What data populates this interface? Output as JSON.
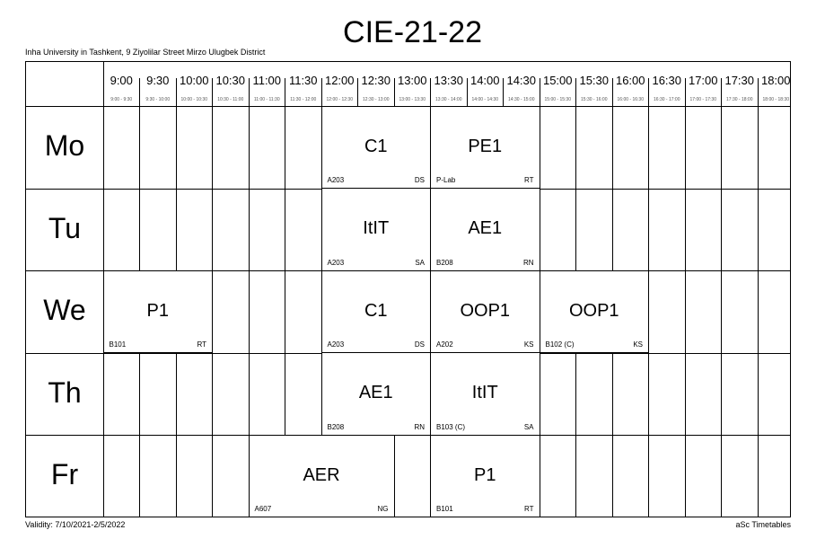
{
  "header": {
    "title": "CIE-21-22",
    "school": "Inha University in Tashkent, 9 Ziyolilar Street Mirzo Ulugbek District"
  },
  "footer": {
    "validity": "Validity: 7/10/2021-2/5/2022",
    "brand": "aSc Timetables"
  },
  "times": [
    {
      "label": "9:00",
      "range": "9:00 - 9:30"
    },
    {
      "label": "9:30",
      "range": "9:30 - 10:00"
    },
    {
      "label": "10:00",
      "range": "10:00 - 10:30"
    },
    {
      "label": "10:30",
      "range": "10:30 - 11:00"
    },
    {
      "label": "11:00",
      "range": "11:00 - 11:30"
    },
    {
      "label": "11:30",
      "range": "11:30 - 12:00"
    },
    {
      "label": "12:00",
      "range": "12:00 - 12:30"
    },
    {
      "label": "12:30",
      "range": "12:30 - 13:00"
    },
    {
      "label": "13:00",
      "range": "13:00 - 13:30"
    },
    {
      "label": "13:30",
      "range": "13:30 - 14:00"
    },
    {
      "label": "14:00",
      "range": "14:00 - 14:30"
    },
    {
      "label": "14:30",
      "range": "14:30 - 15:00"
    },
    {
      "label": "15:00",
      "range": "15:00 - 15:30"
    },
    {
      "label": "15:30",
      "range": "15:30 - 16:00"
    },
    {
      "label": "16:00",
      "range": "16:00 - 16:30"
    },
    {
      "label": "16:30",
      "range": "16:30 - 17:00"
    },
    {
      "label": "17:00",
      "range": "17:00 - 17:30"
    },
    {
      "label": "17:30",
      "range": "17:30 - 18:00"
    },
    {
      "label": "18:00",
      "range": "18:00 - 18:30"
    }
  ],
  "days": [
    "Mo",
    "Tu",
    "We",
    "Th",
    "Fr"
  ],
  "lessons": [
    {
      "day": "Mo",
      "start": "12:00",
      "end": "13:30",
      "subject": "C1",
      "room": "A203",
      "teacher": "DS"
    },
    {
      "day": "Mo",
      "start": "13:30",
      "end": "15:00",
      "subject": "PE1",
      "room": "P-Lab",
      "teacher": "RT"
    },
    {
      "day": "Tu",
      "start": "12:00",
      "end": "13:30",
      "subject": "ItIT",
      "room": "A203",
      "teacher": "SA"
    },
    {
      "day": "Tu",
      "start": "13:30",
      "end": "15:00",
      "subject": "AE1",
      "room": "B208",
      "teacher": "RN"
    },
    {
      "day": "We",
      "start": "9:00",
      "end": "10:30",
      "subject": "P1",
      "room": "B101",
      "teacher": "RT"
    },
    {
      "day": "We",
      "start": "12:00",
      "end": "13:30",
      "subject": "C1",
      "room": "A203",
      "teacher": "DS"
    },
    {
      "day": "We",
      "start": "13:30",
      "end": "15:00",
      "subject": "OOP1",
      "room": "A202",
      "teacher": "KS"
    },
    {
      "day": "We",
      "start": "15:00",
      "end": "16:30",
      "subject": "OOP1",
      "room": "B102 (C)",
      "teacher": "KS"
    },
    {
      "day": "Th",
      "start": "12:00",
      "end": "13:30",
      "subject": "AE1",
      "room": "B208",
      "teacher": "RN"
    },
    {
      "day": "Th",
      "start": "13:30",
      "end": "15:00",
      "subject": "ItIT",
      "room": "B103 (C)",
      "teacher": "SA"
    },
    {
      "day": "Fr",
      "start": "11:00",
      "end": "13:00",
      "subject": "AER",
      "room": "A607",
      "teacher": "NG"
    },
    {
      "day": "Fr",
      "start": "13:30",
      "end": "15:00",
      "subject": "P1",
      "room": "B101",
      "teacher": "RT"
    }
  ]
}
